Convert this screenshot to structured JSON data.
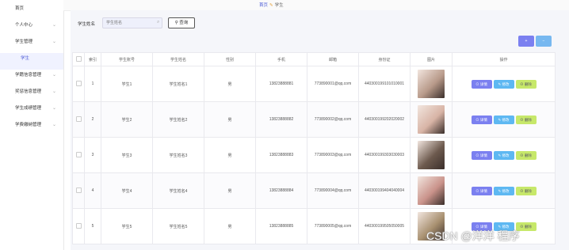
{
  "sidebar": {
    "items": [
      {
        "label": "首页",
        "chevron": ""
      },
      {
        "label": "个人中心",
        "chevron": "⌄"
      },
      {
        "label": "学生管理",
        "chevron": "⌄"
      },
      {
        "label": "学生",
        "chevron": ""
      },
      {
        "label": "学籍信息管理",
        "chevron": "⌄"
      },
      {
        "label": "奖惩信息管理",
        "chevron": "⌄"
      },
      {
        "label": "学生成绩管理",
        "chevron": "⌄"
      },
      {
        "label": "学费缴纳管理",
        "chevron": "⌄"
      }
    ]
  },
  "breadcrumb": {
    "home": "首页",
    "sep": "✎",
    "current": "学生"
  },
  "search": {
    "label": "学生姓名",
    "placeholder": "学生姓名",
    "button": "查询",
    "icon": "search-icon"
  },
  "toolbar": {
    "add": "+",
    "delete": "−"
  },
  "table": {
    "headers": [
      "",
      "索引",
      "学生账号",
      "学生姓名",
      "性别",
      "手机",
      "邮箱",
      "身份证",
      "图片",
      "操作"
    ],
    "rows": [
      {
        "index": "1",
        "account": "学生1",
        "name": "学生姓名1",
        "gender": "男",
        "phone": "13823888881",
        "email": "773890001@qq.com",
        "idcard": "440300199101010001"
      },
      {
        "index": "2",
        "account": "学生2",
        "name": "学生姓名2",
        "gender": "男",
        "phone": "13823888882",
        "email": "773890002@qq.com",
        "idcard": "440300199202020002"
      },
      {
        "index": "3",
        "account": "学生3",
        "name": "学生姓名3",
        "gender": "男",
        "phone": "13823888883",
        "email": "773890003@qq.com",
        "idcard": "440300199303030003"
      },
      {
        "index": "4",
        "account": "学生4",
        "name": "学生姓名4",
        "gender": "男",
        "phone": "13823888884",
        "email": "773890004@qq.com",
        "idcard": "440300199404040004"
      },
      {
        "index": "5",
        "account": "学生5",
        "name": "学生姓名5",
        "gender": "男",
        "phone": "13823888885",
        "email": "773890005@qq.com",
        "idcard": "440300199505050005"
      }
    ],
    "actions": {
      "view": "详情",
      "edit": "修改",
      "delete": "删除"
    }
  },
  "watermark": "CSDN @洋洋  程序",
  "colors": {
    "accent": "#7b80f0",
    "edit": "#5eb8f2",
    "delete": "#c7e86a"
  }
}
